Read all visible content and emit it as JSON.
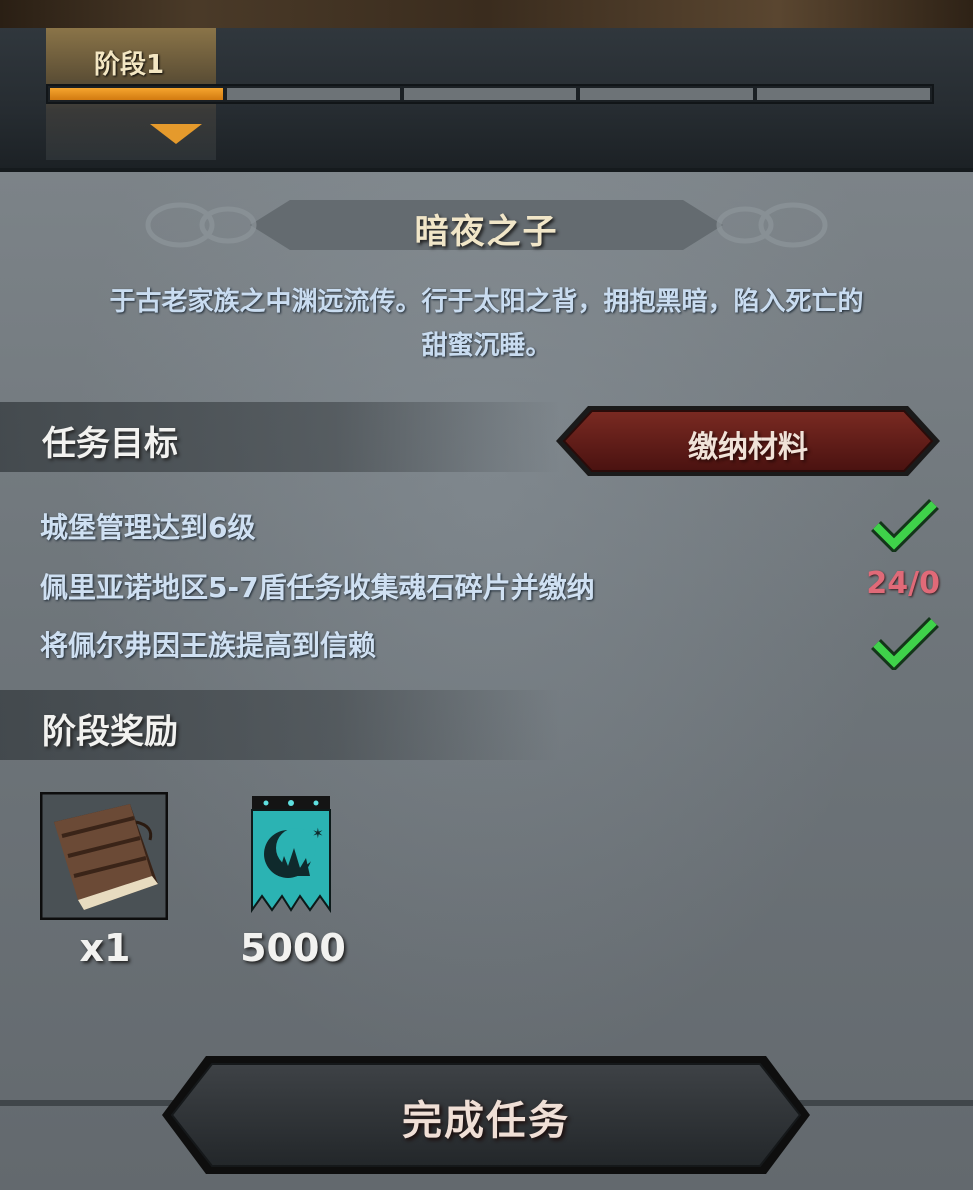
{
  "stage": {
    "tab_label": "阶段1",
    "segments_total": 5,
    "segments_filled": 1
  },
  "quest": {
    "title": "暗夜之子",
    "description_line1": "于古老家族之中渊远流传。行于太阳之背，拥抱黑暗，陷入死亡的",
    "description_line2": "甜蜜沉睡。"
  },
  "objectives": {
    "heading": "任务目标",
    "submit_button": "缴纳材料",
    "items": [
      {
        "text": "城堡管理达到6级",
        "status": "complete"
      },
      {
        "text": "佩里亚诺地区5-7盾任务收集魂石碎片并缴纳",
        "status": "progress",
        "progress": "24/0"
      },
      {
        "text": "将佩尔弗因王族提高到信赖",
        "status": "complete"
      }
    ]
  },
  "rewards": {
    "heading": "阶段奖励",
    "items": [
      {
        "icon": "book-icon",
        "count": "x1"
      },
      {
        "icon": "banner-moon-icon",
        "count": "5000"
      }
    ]
  },
  "complete_button": "完成任务",
  "colors": {
    "accent_orange": "#e59a2c",
    "progress_red": "#e06a78",
    "check_green": "#3fd24a",
    "submit_red": "#6a1e1a",
    "banner_teal": "#2bb3b3"
  }
}
